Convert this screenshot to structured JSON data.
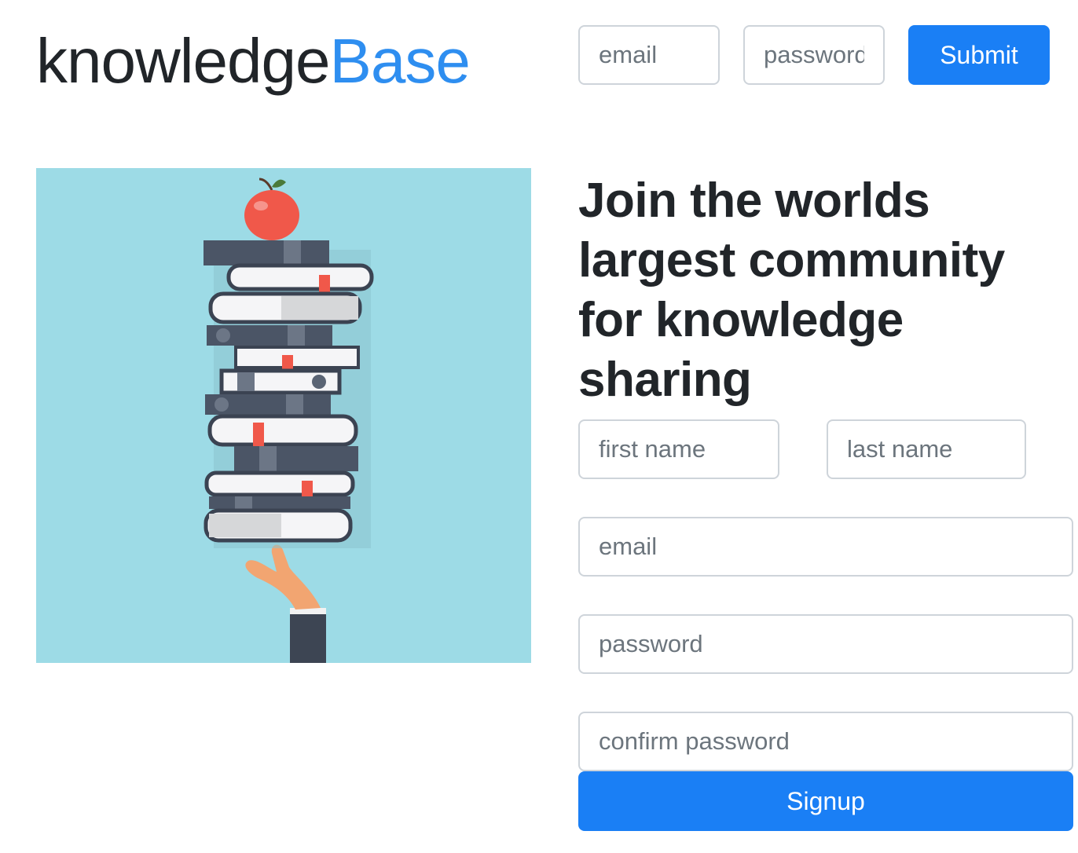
{
  "header": {
    "logo": {
      "part1": "knowledge",
      "part2": "Base",
      "accent_color": "#2e8ef0"
    },
    "login": {
      "email_placeholder": "email",
      "password_placeholder": "password",
      "submit_label": "Submit"
    }
  },
  "hero_image": {
    "description_icon": "stack-of-books-with-apple-icon",
    "background_color": "#9ddbe6"
  },
  "signup": {
    "headline": "Join the worlds largest community for knowledge sharing",
    "first_name_placeholder": "first name",
    "last_name_placeholder": "last name",
    "email_placeholder": "email",
    "password_placeholder": "password",
    "confirm_password_placeholder": "confirm password",
    "signup_label": "Signup"
  },
  "colors": {
    "primary": "#1a7ff5",
    "border": "#ced4da",
    "text": "#212529",
    "placeholder": "#6c757d"
  }
}
